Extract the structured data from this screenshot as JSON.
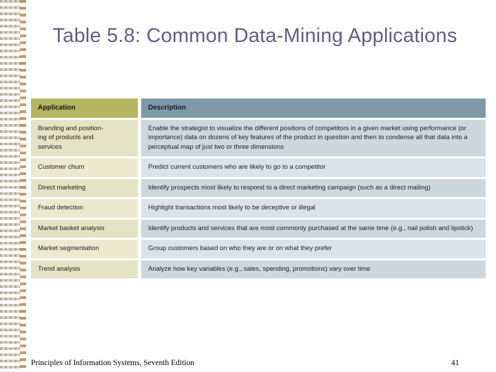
{
  "slide": {
    "title": "Table 5.8: Common Data-Mining Applications",
    "title_color": "#5f5f82",
    "background": "#ffffff"
  },
  "decor": {
    "left_edge_pattern": "checkered-grid-pattern",
    "square_color": "#96969b",
    "accent_color": "#b08c5f",
    "cream_color": "#fffcf3"
  },
  "table": {
    "header": {
      "application": "Application",
      "description": "Description",
      "application_bg": "#b4b55e",
      "description_bg": "#7e9aa9"
    },
    "row_colors": {
      "application_odd": "#e4e3c3",
      "application_even": "#ebeacf",
      "description_odd": "#ccd8de",
      "description_even": "#dbe3e8"
    },
    "rows": [
      {
        "application": "Branding and position-\ning of products and\nservices",
        "description": "Enable the strategist to visualize the different positions of competitors in a given market using performance (or importance) data on dozens of key features of the product in question and then to condense all that data into a perceptual map of just two or three dimensions"
      },
      {
        "application": "Customer churn",
        "description": "Predict current customers who are likely to go to a competitor"
      },
      {
        "application": "Direct marketing",
        "description": "Identify prospects most likely to respond to a direct marketing campaign (such as a direct mailing)"
      },
      {
        "application": "Fraud detection",
        "description": "Highlight transactions most likely to be deceptive or illegal"
      },
      {
        "application": "Market basket analysis",
        "description": "Identify products and services that are most commonly purchased at the same time (e.g., nail polish and lipstick)"
      },
      {
        "application": "Market segmentation",
        "description": "Group customers based on who they are or on what they prefer"
      },
      {
        "application": "Trend analysis",
        "description": "Analyze how key variables (e.g., sales, spending, promotions) vary over time"
      }
    ]
  },
  "footer": {
    "note": "Principles of Information Systems, Seventh Edition",
    "page_number": "41"
  }
}
